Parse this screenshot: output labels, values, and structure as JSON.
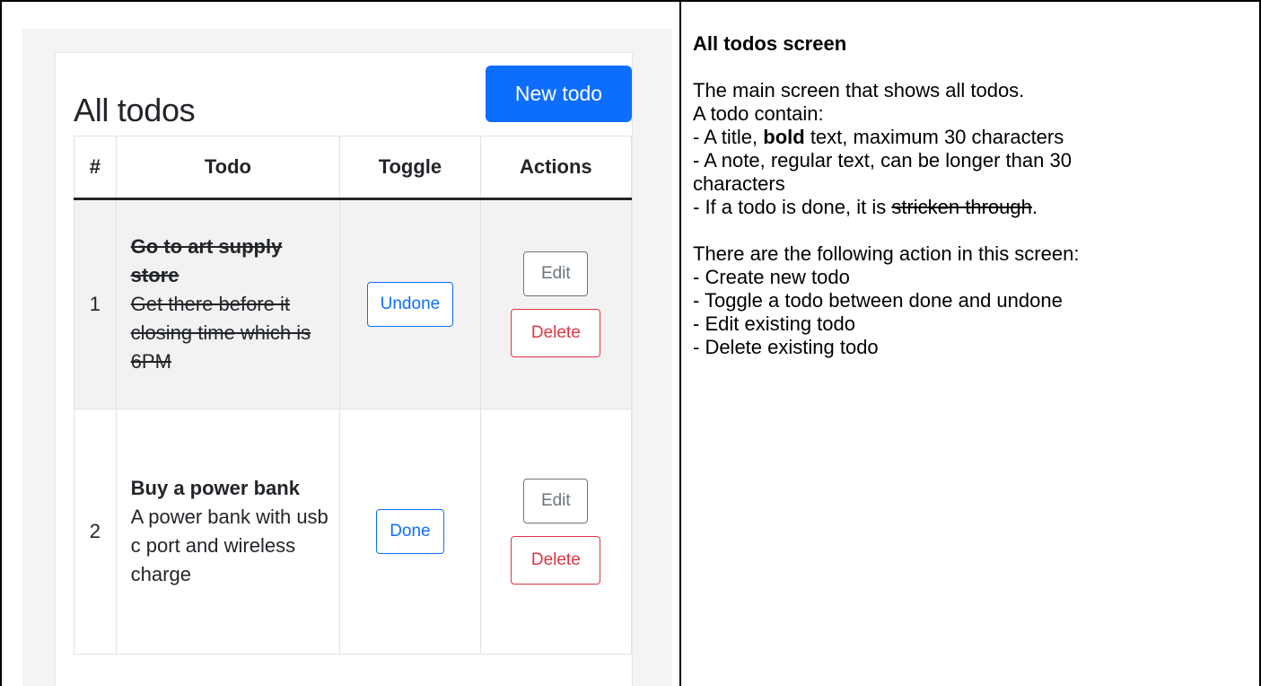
{
  "screen_mockup": {
    "title": "All todos",
    "new_todo_button": "New todo",
    "table": {
      "headers": [
        "#",
        "Todo",
        "Toggle",
        "Actions"
      ],
      "rows": [
        {
          "num": "1",
          "title": "Go to art supply store",
          "note": "Get there before it closing time which is 6PM",
          "done": true,
          "toggle_label": "Undone",
          "edit_label": "Edit",
          "delete_label": "Delete"
        },
        {
          "num": "2",
          "title": "Buy a power bank",
          "note": "A power bank with usb c port and wireless charge",
          "done": false,
          "toggle_label": "Done",
          "edit_label": "Edit",
          "delete_label": "Delete"
        }
      ]
    },
    "colors": {
      "primary": "#0d6efd",
      "danger": "#dc3545",
      "secondary": "#6c757d",
      "done_row_bg": "#f2f2f2"
    }
  },
  "description": {
    "heading": "All todos screen",
    "intro": "The main screen that shows all todos.",
    "contain_line": "A todo contain:",
    "title_line_prefix": "- A title, ",
    "title_line_bold": "bold",
    "title_line_suffix": " text, maximum 30 characters",
    "note_line_1": "- A note, regular text, can be longer than 30",
    "note_line_2": "characters",
    "done_line_prefix": "- If a todo is done, it is ",
    "done_line_struck": "stricken through",
    "done_line_suffix": ".",
    "actions_intro": "There are the following action in this screen:",
    "actions": [
      "- Create new todo",
      "- Toggle a todo between done and undone",
      "- Edit existing todo",
      "- Delete existing todo"
    ]
  }
}
